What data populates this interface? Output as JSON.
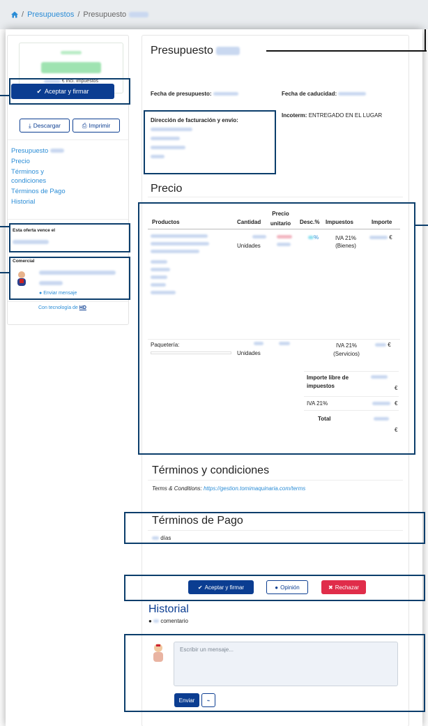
{
  "breadcrumb": {
    "home_icon": "home-icon",
    "item1": "Presupuestos",
    "item2": "Presupuesto"
  },
  "sidebar": {
    "amount_suffix": "€ incl. impuestos",
    "accept_label": "Aceptar y firmar",
    "download_label": "Descargar",
    "print_label": "Imprimir",
    "nav": [
      "Presupuesto",
      "Precio",
      "Términos y condiciones",
      "Términos de Pago",
      "Historial"
    ],
    "expires_label": "Esta oferta vence el",
    "commercial_label": "Comercial",
    "send_message_label": "Enviar mensaje",
    "powered_by": "Con tecnología de"
  },
  "doc": {
    "title": "Presupuesto",
    "date_label": "Fecha de presupuesto:",
    "expiry_label": "Fecha de caducidad:",
    "incoterm_label": "Incoterm:",
    "incoterm_value": "ENTREGADO EN EL LUGAR",
    "billing_label": "Dirección de facturación y envío:"
  },
  "price": {
    "title": "Precio",
    "headers": [
      "Productos",
      "Cantidad",
      "Precio unitario",
      "Desc.%",
      "Impuestos",
      "Importe"
    ],
    "row1": {
      "unit": "Unidades",
      "discount_suffix": "%",
      "tax": "IVA 21% (Bienes)",
      "currency": "€"
    },
    "row2": {
      "product": "Paquetería:",
      "unit": "Unidades",
      "tax": "IVA 21% (Servicios)",
      "currency": "€"
    },
    "subtotal_label": "Importe libre de impuestos",
    "vat_label": "IVA 21%",
    "total_label": "Total",
    "currency": "€"
  },
  "terms": {
    "title": "Términos y condiciones",
    "text_prefix": "Terms & Conditions:",
    "link": "https://gestion.tomimaquinaria.com/terms"
  },
  "payment": {
    "title": "Términos de Pago",
    "days_suffix": "días"
  },
  "actions": {
    "accept": "Aceptar y firmar",
    "feedback": "Opinión",
    "reject": "Rechazar"
  },
  "history": {
    "title": "Historial",
    "comment_suffix": "comentario",
    "placeholder": "Escribir un mensaje...",
    "send": "Enviar"
  },
  "colors": {
    "primary": "#0b3d91",
    "link": "#2a8cd6",
    "reject": "#e02d4a",
    "callout": "#0b3d6b"
  }
}
